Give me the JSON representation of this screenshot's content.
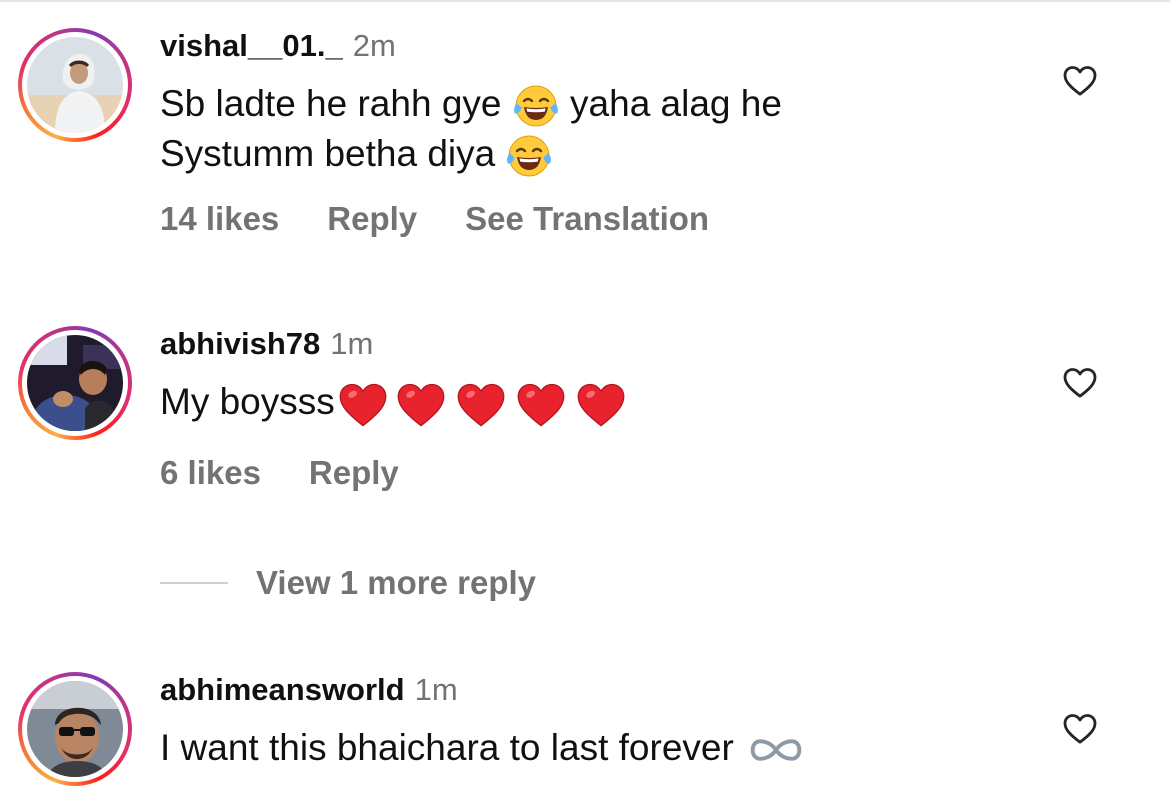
{
  "comments": [
    {
      "username": "vishal__01._",
      "time": "2m",
      "lines": [
        [
          "Sb ladte he rahh gye ",
          " yaha alag he"
        ],
        [
          "Systumm betha diya "
        ]
      ],
      "likes": "14 likes",
      "reply": "Reply",
      "translate": "See Translation",
      "like_icon": "heart-outline-icon"
    },
    {
      "username": "abhivish78",
      "time": "1m",
      "text": "My boysss",
      "emojis": [
        "red-heart",
        "red-heart",
        "red-heart",
        "red-heart",
        "red-heart"
      ],
      "likes": "6 likes",
      "reply": "Reply",
      "like_icon": "heart-outline-icon"
    },
    {
      "username": "abhimeansworld",
      "time": "1m",
      "text": "I want this bhaichara to last forever",
      "emoji": "infinity",
      "like_icon": "heart-outline-icon"
    }
  ],
  "view_more_replies": "View 1 more reply",
  "colors": {
    "text": "#111111",
    "secondary": "#737373",
    "story_ring": [
      "#fcaf45",
      "#f77737",
      "#e1306c",
      "#c13584",
      "#833ab4"
    ],
    "heart_emoji": "#e8232e"
  }
}
